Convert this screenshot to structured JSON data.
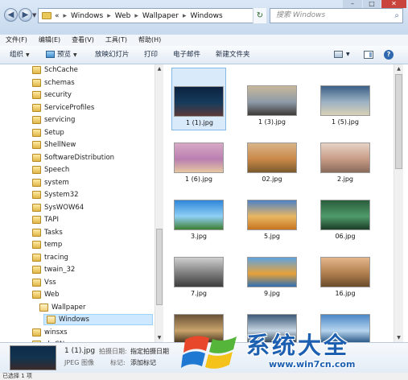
{
  "address": {
    "back_symbol": "◀",
    "forward_symbol": "▶",
    "prefix": "«",
    "segments": [
      "Windows",
      "Web",
      "Wallpaper",
      "Windows"
    ],
    "search_placeholder": "搜索 Windows"
  },
  "window_controls": {
    "minimize": "–",
    "maximize": "□",
    "close": "✕"
  },
  "menu": [
    "文件(F)",
    "编辑(E)",
    "查看(V)",
    "工具(T)",
    "帮助(H)"
  ],
  "toolbar": {
    "organize": "组织",
    "preview": "预览",
    "slideshow": "放映幻灯片",
    "print": "打印",
    "email": "电子邮件",
    "new_folder": "新建文件夹",
    "help": "?"
  },
  "tree": [
    {
      "label": "SchCache",
      "level": 0
    },
    {
      "label": "schemas",
      "level": 0
    },
    {
      "label": "security",
      "level": 0
    },
    {
      "label": "ServiceProfiles",
      "level": 0
    },
    {
      "label": "servicing",
      "level": 0
    },
    {
      "label": "Setup",
      "level": 0
    },
    {
      "label": "ShellNew",
      "level": 0
    },
    {
      "label": "SoftwareDistribution",
      "level": 0
    },
    {
      "label": "Speech",
      "level": 0
    },
    {
      "label": "system",
      "level": 0
    },
    {
      "label": "System32",
      "level": 0
    },
    {
      "label": "SysWOW64",
      "level": 0
    },
    {
      "label": "TAPI",
      "level": 0
    },
    {
      "label": "Tasks",
      "level": 0
    },
    {
      "label": "temp",
      "level": 0
    },
    {
      "label": "tracing",
      "level": 0
    },
    {
      "label": "twain_32",
      "level": 0
    },
    {
      "label": "Vss",
      "level": 0
    },
    {
      "label": "Web",
      "level": 0
    },
    {
      "label": "Wallpaper",
      "level": 1
    },
    {
      "label": "Windows",
      "level": 2,
      "selected": true
    },
    {
      "label": "winsxs",
      "level": 0
    },
    {
      "label": "zh-CN",
      "level": 0
    }
  ],
  "files": [
    {
      "name": "1 (1).jpg",
      "selected": true,
      "colors": [
        "#0b2240",
        "#163b5c",
        "#5b3a3a"
      ]
    },
    {
      "name": "1 (3).jpg",
      "colors": [
        "#c9b89a",
        "#8d9aa8",
        "#3e3a36"
      ]
    },
    {
      "name": "1 (5).jpg",
      "colors": [
        "#3b5f86",
        "#9cb2c4",
        "#d9d0b5"
      ]
    },
    {
      "name": "1 (6).jpg",
      "colors": [
        "#d8a9c6",
        "#b97fb0",
        "#e6c7a2"
      ]
    },
    {
      "name": "02.jpg",
      "colors": [
        "#d9b48a",
        "#c98848",
        "#7b5a2c"
      ]
    },
    {
      "name": "2.jpg",
      "colors": [
        "#e6d3c5",
        "#c79b86",
        "#8a6a5a"
      ]
    },
    {
      "name": "3.jpg",
      "colors": [
        "#2f86d9",
        "#8fd0f5",
        "#3f7f32"
      ]
    },
    {
      "name": "5.jpg",
      "colors": [
        "#4f82c6",
        "#e9b763",
        "#c7741f"
      ]
    },
    {
      "name": "06.jpg",
      "colors": [
        "#2a5d3c",
        "#4f9b6a",
        "#1b3d28"
      ]
    },
    {
      "name": "7.jpg",
      "colors": [
        "#cfcfcf",
        "#7c7c7c",
        "#3d3d3d"
      ]
    },
    {
      "name": "9.jpg",
      "colors": [
        "#5fa3e0",
        "#e7a23a",
        "#2f6fb3"
      ]
    },
    {
      "name": "16.jpg",
      "colors": [
        "#e3b68a",
        "#b07e4e",
        "#6a4a2a"
      ]
    },
    {
      "name": "",
      "colors": [
        "#6a5238",
        "#c9a36b",
        "#3a2a18"
      ]
    },
    {
      "name": "",
      "colors": [
        "#3d5a78",
        "#c7d6e4",
        "#22364a"
      ]
    },
    {
      "name": "",
      "colors": [
        "#4a86c6",
        "#b6d5ef",
        "#1a4a7a"
      ]
    }
  ],
  "details": {
    "name": "1 (1).jpg",
    "type": "JPEG 图像",
    "date_label": "拍摄日期:",
    "date_value": "指定拍摄日期",
    "tags_label": "标记:",
    "tags_value": "添加标记"
  },
  "status": "已选择 1 项",
  "watermark": {
    "title": "系统大全",
    "url": "www.win7cn.com"
  }
}
